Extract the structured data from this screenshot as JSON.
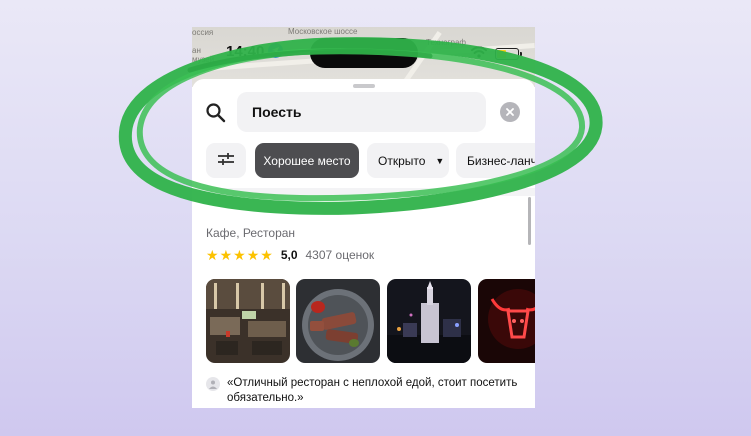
{
  "map": {
    "labels": [
      "оссия",
      "Московское шоссе",
      "Технограф",
      "ан",
      "музей",
      "еях"
    ]
  },
  "status_bar": {
    "time": "14:40",
    "icons": [
      "location-arrow-icon",
      "wifi-icon",
      "battery-icon"
    ],
    "battery_color": "#f6cf14"
  },
  "search": {
    "query": "Поесть",
    "icon": "search-icon",
    "clear_icon": "close-icon"
  },
  "chips": {
    "filter_icon": "filter-sliders-icon",
    "good_place": "Хорошее место",
    "open": "Открыто",
    "open_arrow": "▼",
    "business_lunch": "Бизнес-ланч"
  },
  "place": {
    "category": "Кафе, Ресторан",
    "rating": "5,0",
    "reviews": "4307 оценок",
    "stars": 5,
    "photos": [
      "restaurant-interior-photo",
      "steak-plate-photo",
      "night-building-photo",
      "red-neon-bull-photo"
    ],
    "quote": "«Отличный ресторан с неплохой едой, стоит посетить обязательно.»"
  },
  "colors": {
    "accent_dark_chip": "#4d4d50",
    "star": "#fcc200",
    "highlight_stroke": "#2fb24a",
    "location": "#2f7ef6"
  }
}
